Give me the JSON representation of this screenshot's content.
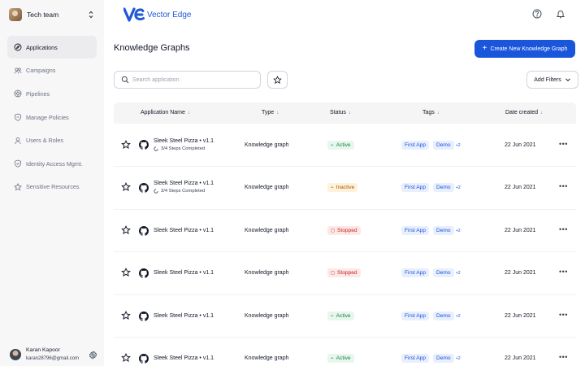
{
  "sidebar": {
    "team": {
      "name": "Tech team"
    },
    "items": [
      {
        "label": "Applications",
        "icon": "compass-icon",
        "active": true
      },
      {
        "label": "Campaigns",
        "icon": "people-icon",
        "active": false
      },
      {
        "label": "Pipelines",
        "icon": "pipeline-icon",
        "active": false
      },
      {
        "label": "Manage Policies",
        "icon": "shield-icon",
        "active": false
      },
      {
        "label": "Users & Roles",
        "icon": "user-icon",
        "active": false
      },
      {
        "label": "Identity Access Mgmt.",
        "icon": "shield-check-icon",
        "active": false
      },
      {
        "label": "Sensitive Resources",
        "icon": "star-icon",
        "active": false
      }
    ],
    "user": {
      "name": "Karan Kapoor",
      "email": "karan28796@gmail.com"
    }
  },
  "header": {
    "brand_name": "Vector Edge",
    "brand_color": "#1f57d6"
  },
  "main": {
    "title": "Knowledge Graphs",
    "create_button": "Create New Knowledge Graph",
    "search_placeholder": "Search application",
    "add_filters": "Add Filters",
    "accent_color": "#1a56db"
  },
  "table": {
    "columns": {
      "name": "Application Name",
      "type": "Type",
      "status": "Status",
      "tags": "Tags",
      "date": "Date created"
    },
    "rows": [
      {
        "name": "Sleek Steel Pizza • v1.1",
        "steps": "3/4 Steps Completed",
        "type": "Knowledge graph",
        "status": "Active",
        "status_kind": "active",
        "tags": [
          "First App",
          "Demo"
        ],
        "more_tags": "+2",
        "date": "22 Jun 2021"
      },
      {
        "name": "Sleek Steel Pizza • v1.1",
        "steps": "3/4 Steps Completed",
        "type": "Knowledge graph",
        "status": "Inactive",
        "status_kind": "inactive",
        "tags": [
          "First App",
          "Demo"
        ],
        "more_tags": "+2",
        "date": "22 Jun 2021"
      },
      {
        "name": "Sleek Steel Pizza • v1.1",
        "steps": "",
        "type": "Knowledge graph",
        "status": "Stopped",
        "status_kind": "stopped",
        "tags": [
          "First App",
          "Demo"
        ],
        "more_tags": "+2",
        "date": "22 Jun 2021"
      },
      {
        "name": "Sleek Steel Pizza • v1.1",
        "steps": "",
        "type": "Knowledge graph",
        "status": "Stopped",
        "status_kind": "stopped",
        "tags": [
          "First App",
          "Demo"
        ],
        "more_tags": "+2",
        "date": "22 Jun 2021"
      },
      {
        "name": "Sleek Steel Pizza • v1.1",
        "steps": "",
        "type": "Knowledge graph",
        "status": "Active",
        "status_kind": "active",
        "tags": [
          "First App",
          "Demo"
        ],
        "more_tags": "+2",
        "date": "22 Jun 2021"
      },
      {
        "name": "Sleek Steel Pizza • v1.1",
        "steps": "",
        "type": "Knowledge graph",
        "status": "Active",
        "status_kind": "active",
        "tags": [
          "First App",
          "Demo"
        ],
        "more_tags": "+2",
        "date": "22 Jun 2021"
      }
    ]
  }
}
